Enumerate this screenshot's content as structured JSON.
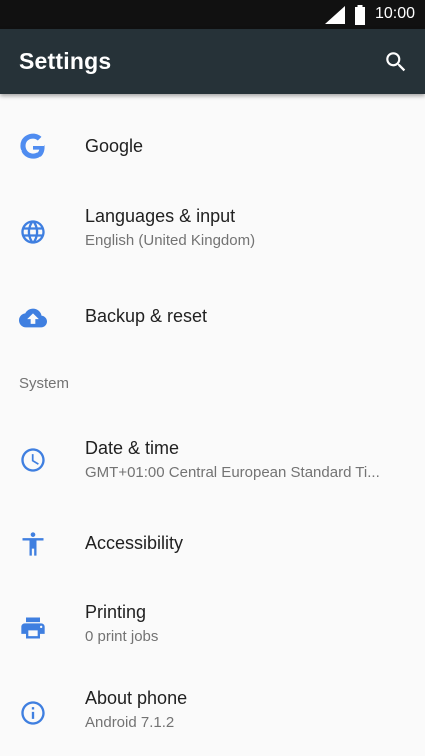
{
  "status_bar": {
    "time": "10:00",
    "signal_icon": "signal-icon",
    "battery_icon": "battery-icon"
  },
  "app_bar": {
    "title": "Settings",
    "search_icon": "search-icon"
  },
  "colors": {
    "app_bar": "#263238",
    "accent": "#3f7fe0",
    "status_bar": "#111111"
  },
  "items": [
    {
      "label": "Google",
      "icon": "google-icon"
    },
    {
      "label": "Languages & input",
      "summary": "English (United Kingdom)",
      "icon": "globe-icon"
    },
    {
      "label": "Backup & reset",
      "icon": "cloud-upload-icon"
    }
  ],
  "section": {
    "label": "System"
  },
  "system_items": [
    {
      "label": "Date & time",
      "summary": "GMT+01:00 Central European Standard Ti...",
      "icon": "clock-icon"
    },
    {
      "label": "Accessibility",
      "icon": "accessibility-icon"
    },
    {
      "label": "Printing",
      "summary": "0 print jobs",
      "icon": "printer-icon"
    },
    {
      "label": "About phone",
      "summary": "Android 7.1.2",
      "icon": "info-icon"
    }
  ]
}
